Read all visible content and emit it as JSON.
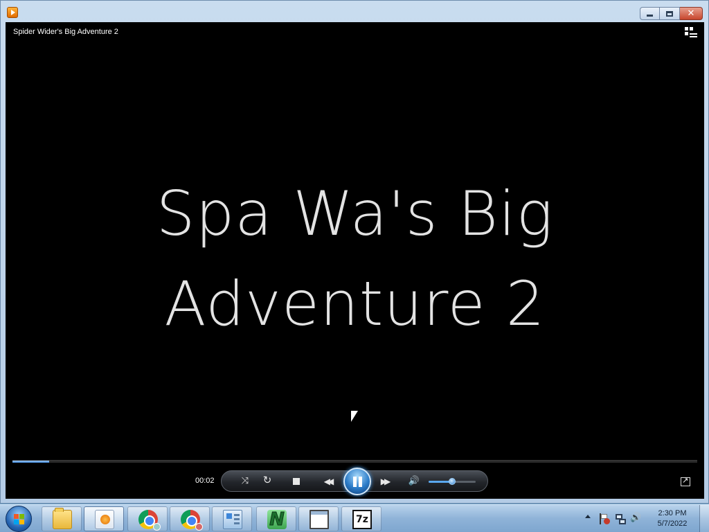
{
  "window": {
    "video_title": "Spider Wider's Big Adventure 2",
    "caption_buttons": {
      "minimize": "minimize",
      "maximize": "restore",
      "close": "✕"
    }
  },
  "video": {
    "line1": "Spa Wa's Big",
    "line2": "Adventure 2"
  },
  "playback": {
    "elapsed": "00:02",
    "progress_fraction": 0.054,
    "volume_fraction": 0.5,
    "state": "playing",
    "icons": {
      "shuffle": "⤨",
      "repeat": "↻",
      "previous": "◀◀",
      "next": "▶▶",
      "mute": "🔊"
    }
  },
  "taskbar": {
    "items": [
      {
        "name": "explorer",
        "icon": "folder-icon"
      },
      {
        "name": "windows-media-player",
        "icon": "media-player-icon",
        "active": true
      },
      {
        "name": "chrome-profile-1",
        "icon": "chrome-icon"
      },
      {
        "name": "chrome-profile-2",
        "icon": "chrome-icon"
      },
      {
        "name": "control-panel",
        "icon": "control-panel-icon"
      },
      {
        "name": "n-app",
        "icon": "n-app-icon",
        "label": "N"
      },
      {
        "name": "window",
        "icon": "window-icon"
      },
      {
        "name": "7zip",
        "icon": "7zip-icon",
        "label": "7z"
      }
    ],
    "clock": {
      "time": "2:30 PM",
      "date": "5/7/2022"
    }
  },
  "colors": {
    "accent": "#3d86d9",
    "player_background": "#000000",
    "taskbar": "#8fb3d8"
  }
}
